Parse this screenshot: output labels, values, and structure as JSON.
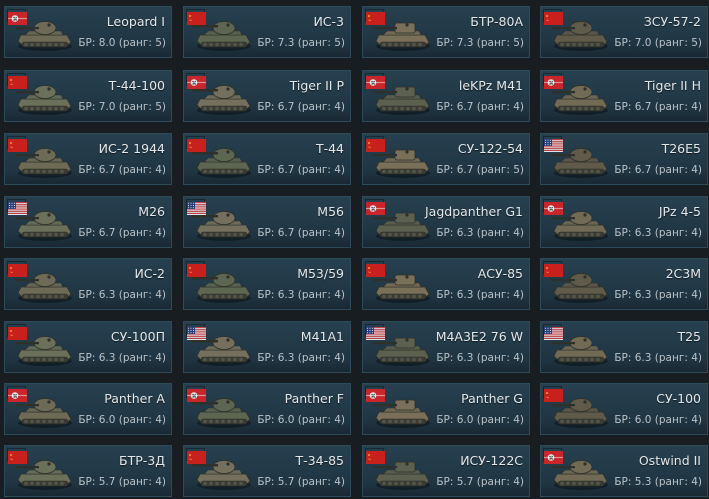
{
  "colors": {
    "background": "#181d21",
    "card": "#253d4b",
    "name_text": "#e3e7ea",
    "br_text": "#b9c2c8"
  },
  "vehicles": [
    {
      "name": "Leopard I",
      "br": "БР: 8.0 (ранг: 5)",
      "nation": "germany-flag"
    },
    {
      "name": "ИС-3",
      "br": "БР: 7.3 (ранг: 5)",
      "nation": "ussr-flag"
    },
    {
      "name": "БТР-80А",
      "br": "БР: 7.3 (ранг: 5)",
      "nation": "ussr-flag"
    },
    {
      "name": "ЗСУ-57-2",
      "br": "БР: 7.0 (ранг: 5)",
      "nation": "ussr-flag"
    },
    {
      "name": "Т-44-100",
      "br": "БР: 7.0 (ранг: 5)",
      "nation": "ussr-flag"
    },
    {
      "name": "Tiger II P",
      "br": "БР: 6.7 (ранг: 4)",
      "nation": "germany-flag"
    },
    {
      "name": "leKPz M41",
      "br": "БР: 6.7 (ранг: 4)",
      "nation": "germany-flag"
    },
    {
      "name": "Tiger II H",
      "br": "БР: 6.7 (ранг: 4)",
      "nation": "germany-flag"
    },
    {
      "name": "ИС-2 1944",
      "br": "БР: 6.7 (ранг: 4)",
      "nation": "ussr-flag"
    },
    {
      "name": "Т-44",
      "br": "БР: 6.7 (ранг: 4)",
      "nation": "ussr-flag"
    },
    {
      "name": "СУ-122-54",
      "br": "БР: 6.7 (ранг: 5)",
      "nation": "ussr-flag"
    },
    {
      "name": "T26E5",
      "br": "БР: 6.7 (ранг: 4)",
      "nation": "usa-flag"
    },
    {
      "name": "M26",
      "br": "БР: 6.7 (ранг: 4)",
      "nation": "usa-flag"
    },
    {
      "name": "M56",
      "br": "БР: 6.7 (ранг: 4)",
      "nation": "usa-flag"
    },
    {
      "name": "Jagdpanther G1",
      "br": "БР: 6.3 (ранг: 4)",
      "nation": "germany-flag"
    },
    {
      "name": "JPz 4-5",
      "br": "БР: 6.3 (ранг: 4)",
      "nation": "germany-flag"
    },
    {
      "name": "ИС-2",
      "br": "БР: 6.3 (ранг: 4)",
      "nation": "ussr-flag"
    },
    {
      "name": "M53/59",
      "br": "БР: 6.3 (ранг: 4)",
      "nation": "ussr-flag"
    },
    {
      "name": "АСУ-85",
      "br": "БР: 6.3 (ранг: 4)",
      "nation": "ussr-flag"
    },
    {
      "name": "2С3М",
      "br": "БР: 6.3 (ранг: 4)",
      "nation": "ussr-flag"
    },
    {
      "name": "СУ-100П",
      "br": "БР: 6.3 (ранг: 4)",
      "nation": "ussr-flag"
    },
    {
      "name": "M41A1",
      "br": "БР: 6.3 (ранг: 4)",
      "nation": "usa-flag"
    },
    {
      "name": "M4A3E2 76 W",
      "br": "БР: 6.3 (ранг: 4)",
      "nation": "usa-flag"
    },
    {
      "name": "T25",
      "br": "БР: 6.3 (ранг: 4)",
      "nation": "usa-flag"
    },
    {
      "name": "Panther A",
      "br": "БР: 6.0 (ранг: 4)",
      "nation": "germany-flag"
    },
    {
      "name": "Panther F",
      "br": "БР: 6.0 (ранг: 4)",
      "nation": "germany-flag"
    },
    {
      "name": "Panther G",
      "br": "БР: 6.0 (ранг: 4)",
      "nation": "germany-flag"
    },
    {
      "name": "СУ-100",
      "br": "БР: 6.0 (ранг: 4)",
      "nation": "ussr-flag"
    },
    {
      "name": "БТР-3Д",
      "br": "БР: 5.7 (ранг: 4)",
      "nation": "ussr-flag"
    },
    {
      "name": "Т-34-85",
      "br": "БР: 5.7 (ранг: 4)",
      "nation": "ussr-flag"
    },
    {
      "name": "ИСУ-122С",
      "br": "БР: 5.7 (ранг: 4)",
      "nation": "ussr-flag"
    },
    {
      "name": "Ostwind II",
      "br": "БР: 5.3 (ранг: 4)",
      "nation": "germany-flag"
    }
  ]
}
